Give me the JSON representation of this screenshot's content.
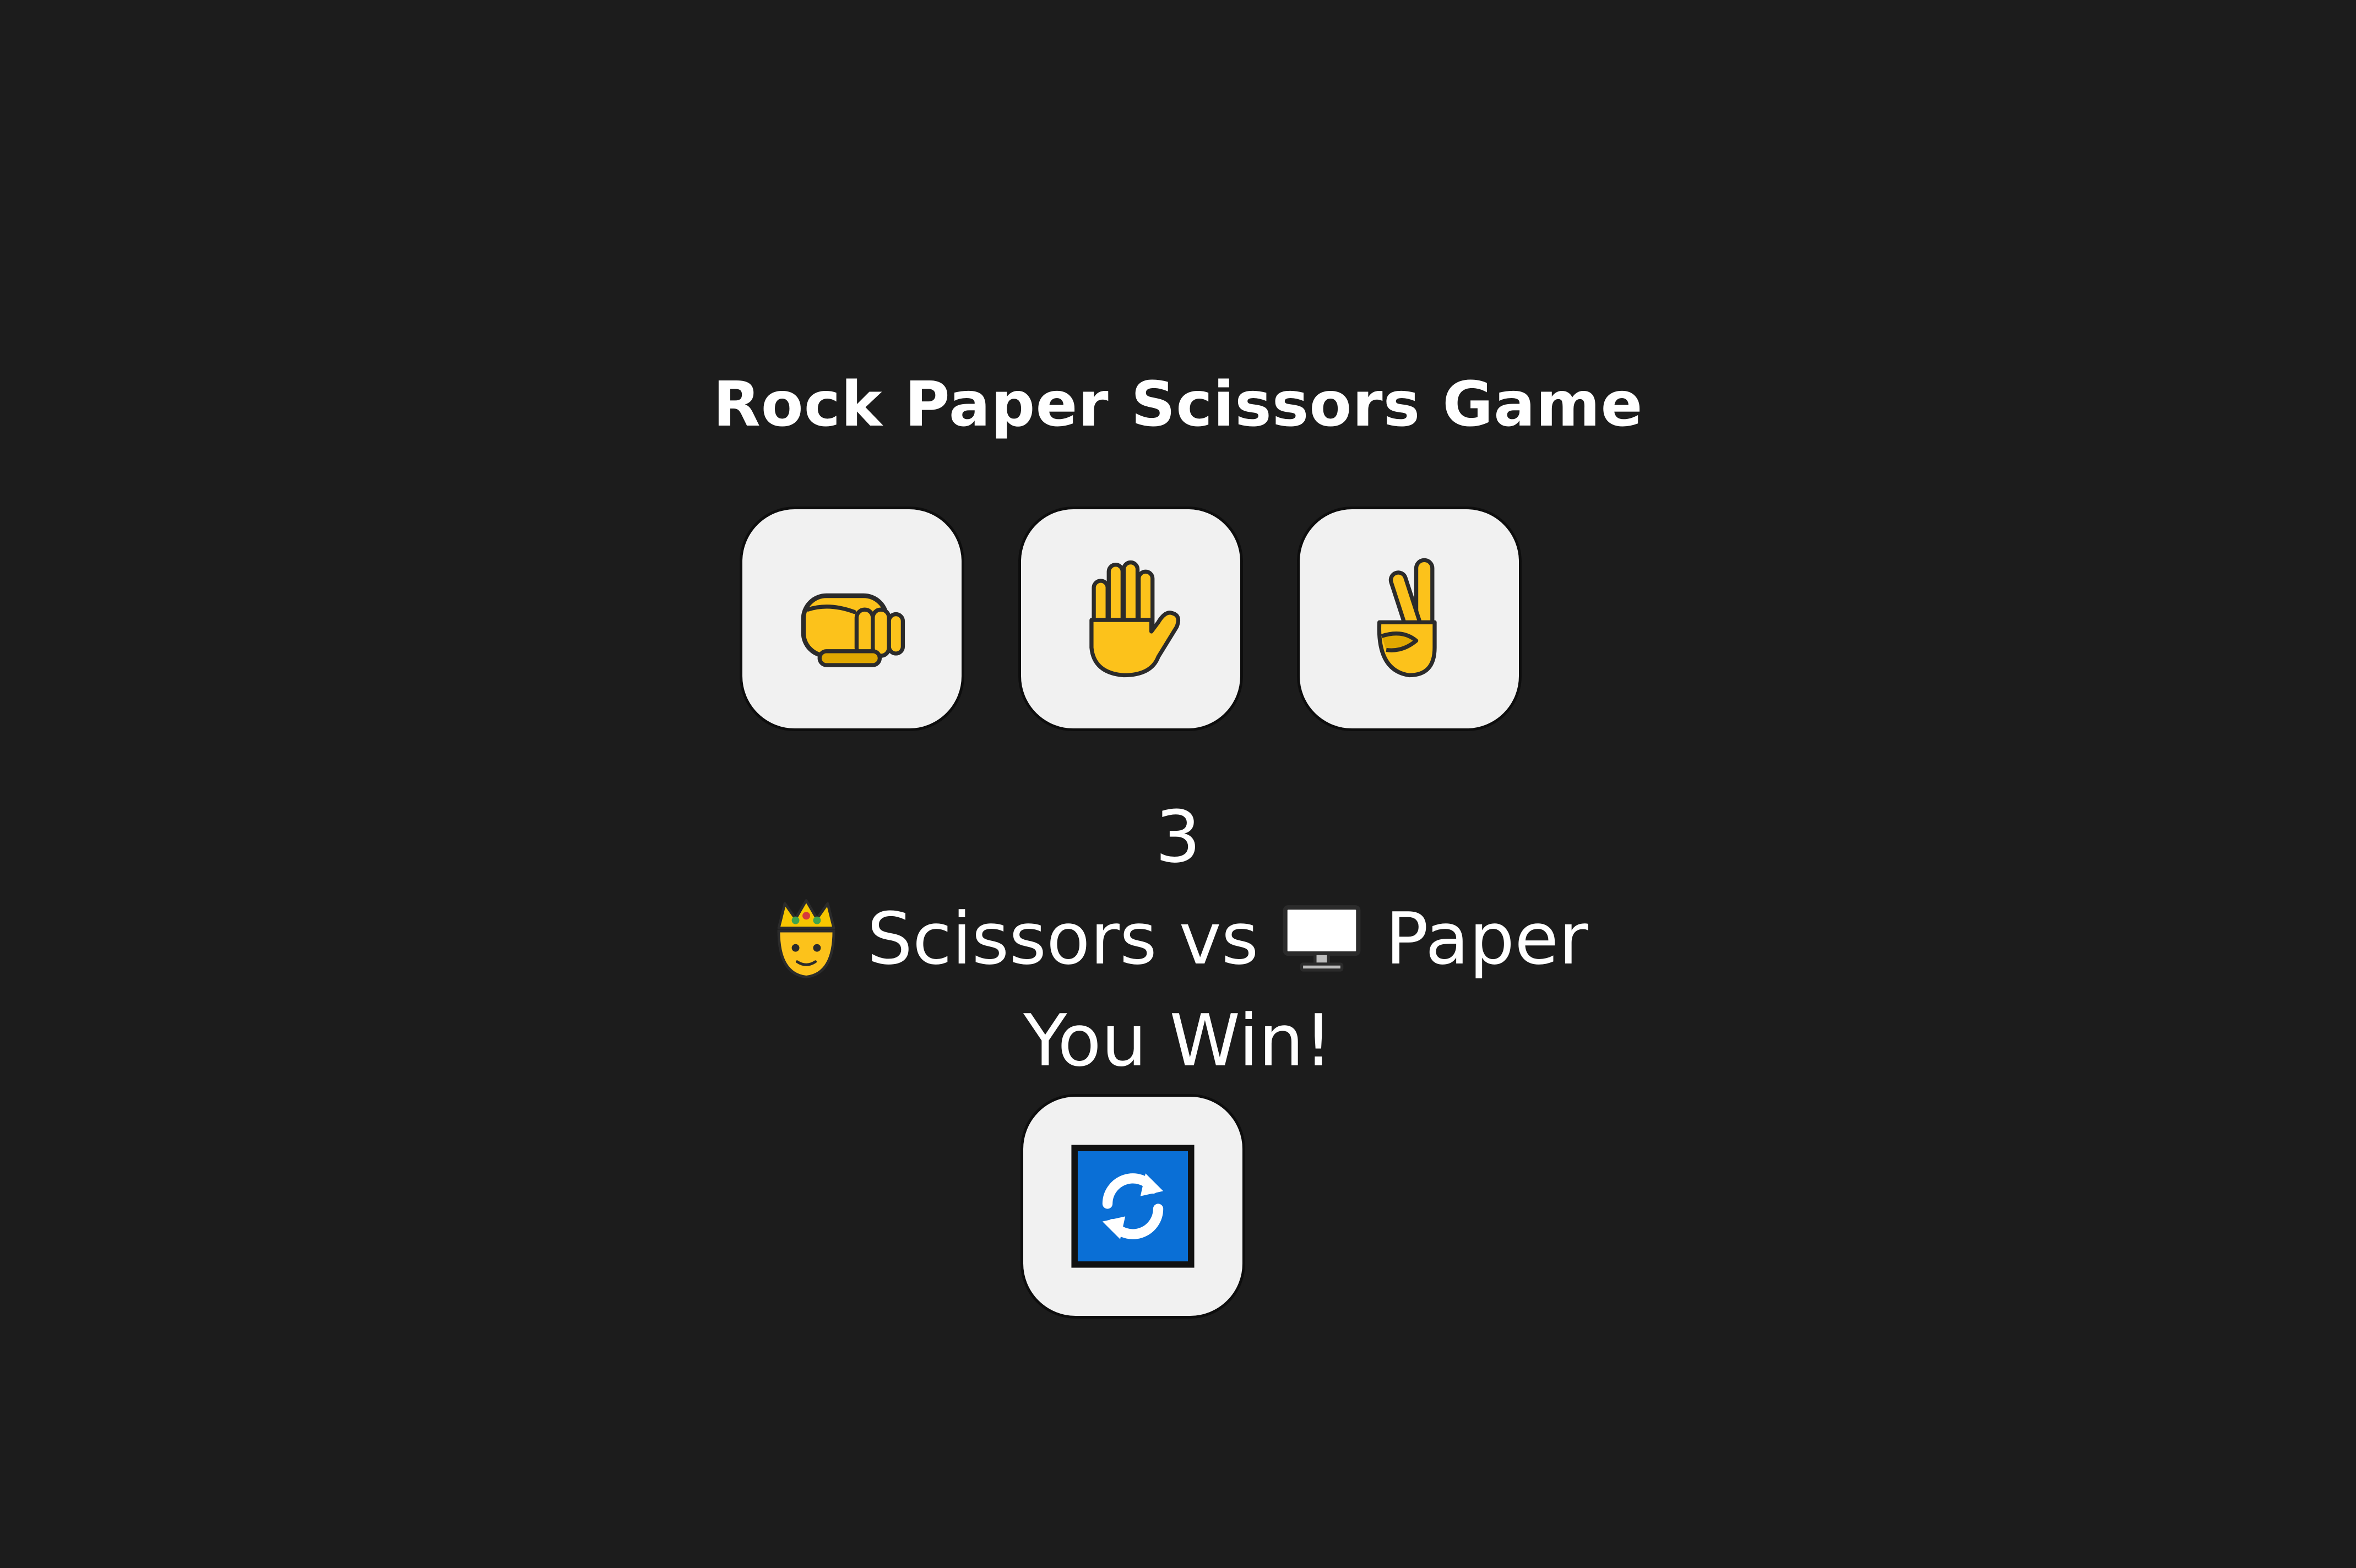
{
  "game": {
    "title": "Rock Paper Scissors Game",
    "choices": [
      {
        "name": "rock",
        "icon": "fist-icon"
      },
      {
        "name": "paper",
        "icon": "raised-hand-icon"
      },
      {
        "name": "scissors",
        "icon": "victory-hand-icon"
      }
    ],
    "countdown": "3",
    "player_icon": "prince-icon",
    "player_choice": "Scissors",
    "versus": "vs",
    "computer_icon": "computer-monitor-icon",
    "computer_choice": "Paper",
    "result": "You Win!",
    "restart_icon": "refresh-icon"
  },
  "colors": {
    "background": "#1c1c1c",
    "button": "#f1f1f1",
    "hand": "#fcc21b",
    "refresh_blue": "#0a6fd6"
  }
}
